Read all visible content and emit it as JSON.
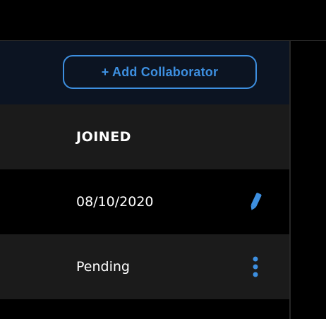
{
  "toolbar": {
    "add_collaborator_label": "+ Add Collaborator"
  },
  "table": {
    "columns": {
      "joined": "JOINED"
    },
    "rows": [
      {
        "joined": "08/10/2020",
        "action_icon": "pencil-icon"
      },
      {
        "joined": "Pending",
        "action_icon": "more-vertical-icon"
      }
    ]
  },
  "colors": {
    "accent": "#3d8fe0",
    "header_strip": "#0c1422",
    "row_alt": "#1b1b1b",
    "background": "#000000"
  }
}
